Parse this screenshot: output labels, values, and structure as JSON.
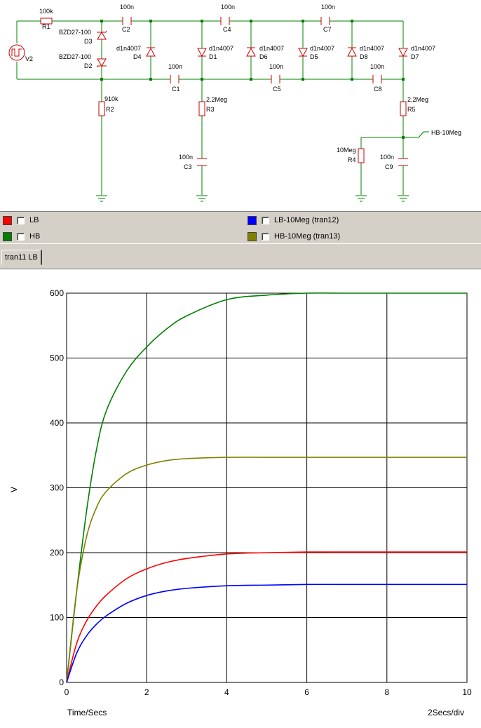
{
  "schematic": {
    "source_label": "V2",
    "components": [
      {
        "ref": "R1",
        "value": "100k"
      },
      {
        "ref": "C2",
        "value": "100n"
      },
      {
        "ref": "C4",
        "value": "100n"
      },
      {
        "ref": "C7",
        "value": "100n"
      },
      {
        "ref": "D3",
        "value": "BZD27-100"
      },
      {
        "ref": "D2",
        "value": "BZD27-100"
      },
      {
        "ref": "D4",
        "value": "d1n4007"
      },
      {
        "ref": "D1",
        "value": "d1n4007"
      },
      {
        "ref": "D6",
        "value": "d1n4007"
      },
      {
        "ref": "D5",
        "value": "d1n4007"
      },
      {
        "ref": "D8",
        "value": "d1n4007"
      },
      {
        "ref": "D7",
        "value": "d1n4007"
      },
      {
        "ref": "C1",
        "value": "100n"
      },
      {
        "ref": "C5",
        "value": "100n"
      },
      {
        "ref": "C8",
        "value": "100n"
      },
      {
        "ref": "R2",
        "value": "910k"
      },
      {
        "ref": "R3",
        "value": "2.2Meg"
      },
      {
        "ref": "R5",
        "value": "2.2Meg"
      },
      {
        "ref": "C3",
        "value": "100n"
      },
      {
        "ref": "R4",
        "value": "10Meg"
      },
      {
        "ref": "C9",
        "value": "100n"
      }
    ],
    "probe_label": "HB-10Meg"
  },
  "legend": [
    {
      "label": "LB",
      "color": "#ff0000"
    },
    {
      "label": "HB",
      "color": "#008000"
    },
    {
      "label": "LB-10Meg (tran12)",
      "color": "#0000ff"
    },
    {
      "label": "HB-10Meg (tran13)",
      "color": "#808000"
    }
  ],
  "tabs": [
    {
      "label": "tran11 LB"
    }
  ],
  "chart_data": {
    "type": "line",
    "xlabel": "Time/Secs",
    "ylabel": "V",
    "x_div_label": "2Secs/div",
    "xlim": [
      0,
      10
    ],
    "ylim": [
      0,
      600
    ],
    "xticks": [
      0,
      2,
      4,
      6,
      8,
      10
    ],
    "yticks": [
      100,
      200,
      300,
      400,
      500,
      600
    ],
    "grid": true,
    "x": [
      0,
      0.25,
      0.5,
      0.75,
      1,
      1.5,
      2,
      2.5,
      3,
      4,
      5,
      6,
      7,
      8,
      9,
      10
    ],
    "series": [
      {
        "name": "HB",
        "color": "#008000",
        "values": [
          0,
          140,
          265,
          360,
          420,
          480,
          517,
          545,
          565,
          590,
          597,
          600,
          600,
          600,
          600,
          600
        ]
      },
      {
        "name": "HB-10Meg (tran13)",
        "color": "#808000",
        "values": [
          0,
          140,
          225,
          270,
          295,
          322,
          335,
          342,
          345,
          347,
          347,
          347,
          347,
          347,
          347,
          347
        ]
      },
      {
        "name": "LB",
        "color": "#ff0000",
        "values": [
          0,
          60,
          95,
          118,
          135,
          160,
          175,
          185,
          191,
          198,
          200,
          201,
          201,
          201,
          201,
          201
        ]
      },
      {
        "name": "LB-10Meg (tran12)",
        "color": "#0000ff",
        "values": [
          0,
          45,
          72,
          90,
          103,
          122,
          134,
          141,
          145,
          149,
          150,
          151,
          151,
          151,
          151,
          151
        ]
      }
    ]
  }
}
